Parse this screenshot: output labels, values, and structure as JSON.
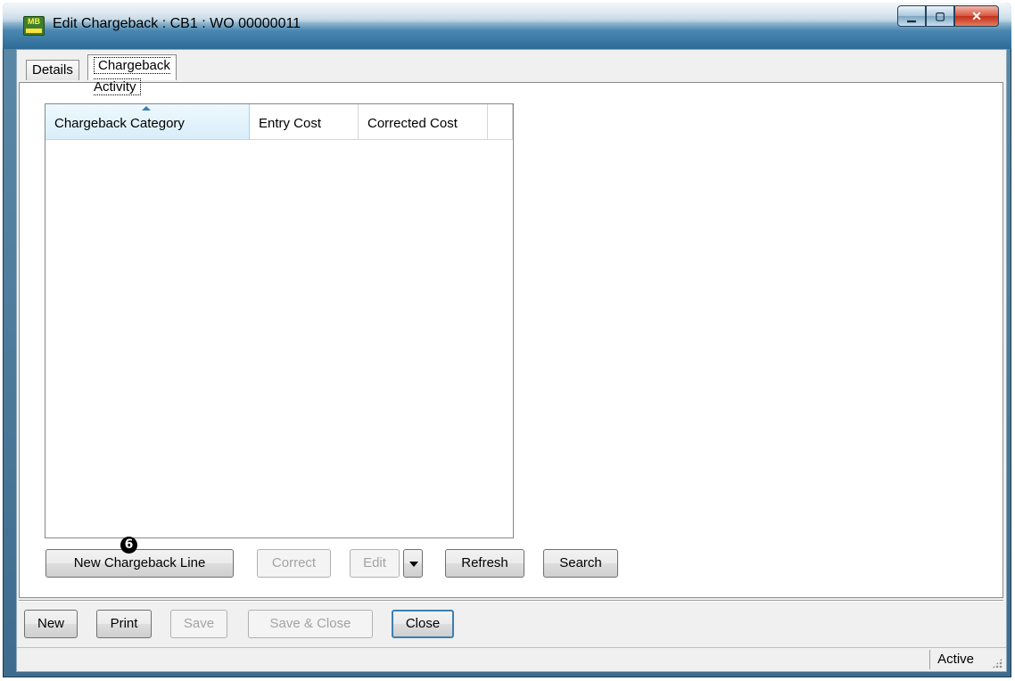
{
  "window": {
    "title": "Edit Chargeback : CB1 : WO 00000011",
    "app_icon_label": "MB"
  },
  "tabs": [
    {
      "label": "Details",
      "active": false
    },
    {
      "label": "Chargeback Activity",
      "active": true
    }
  ],
  "list": {
    "columns": [
      {
        "label": "Chargeback Category",
        "sorted": "ascending"
      },
      {
        "label": "Entry Cost"
      },
      {
        "label": "Corrected Cost"
      }
    ],
    "rows": []
  },
  "panel_buttons": {
    "new_line": {
      "label": "New Chargeback Line",
      "enabled": true
    },
    "correct": {
      "label": "Correct",
      "enabled": false
    },
    "edit": {
      "label": "Edit",
      "enabled": false
    },
    "refresh": {
      "label": "Refresh",
      "enabled": true
    },
    "search": {
      "label": "Search",
      "enabled": true
    }
  },
  "callout": {
    "label": "6"
  },
  "footer_buttons": {
    "new": {
      "label": "New",
      "enabled": true
    },
    "print": {
      "label": "Print",
      "enabled": true
    },
    "save": {
      "label": "Save",
      "enabled": false
    },
    "save_close": {
      "label": "Save & Close",
      "enabled": false
    },
    "close": {
      "label": "Close",
      "enabled": true
    }
  },
  "status": {
    "text": "Active"
  },
  "icons": [
    "app-icon",
    "minimize-icon",
    "maximize-icon",
    "close-icon",
    "sort-ascending-icon",
    "dropdown-arrow-icon",
    "resize-grip-icon"
  ]
}
